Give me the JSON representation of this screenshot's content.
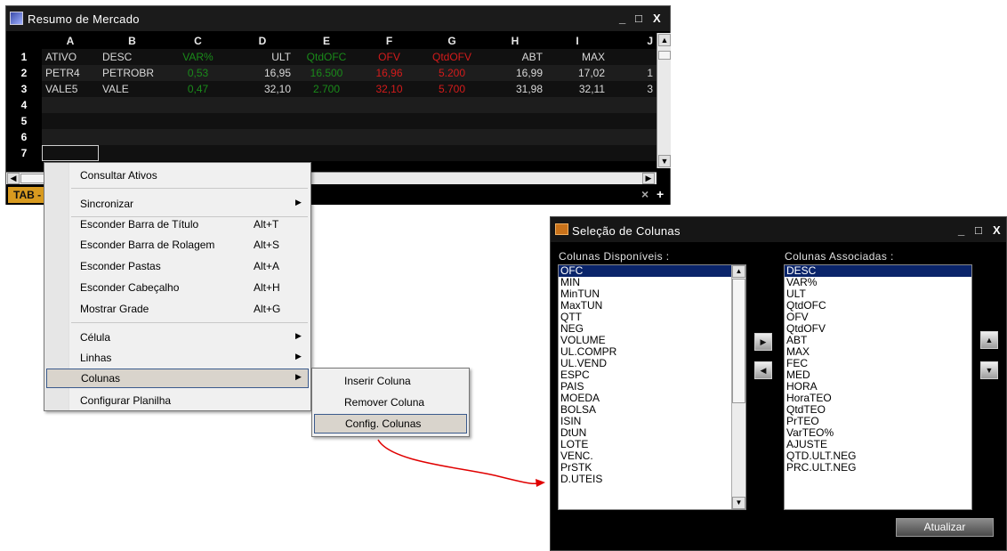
{
  "market_window": {
    "title": "Resumo de Mercado",
    "controls": {
      "minimize": "_",
      "maximize": "□",
      "close": "X"
    },
    "column_letters": [
      "A",
      "B",
      "C",
      "D",
      "E",
      "F",
      "G",
      "H",
      "I",
      "J"
    ],
    "row_numbers": [
      "1",
      "2",
      "3",
      "4",
      "5",
      "6",
      "7"
    ],
    "rows": [
      [
        "ATIVO",
        "DESC",
        "VAR%",
        "ULT",
        "QtdOFC",
        "OFV",
        "QtdOFV",
        "ABT",
        "MAX",
        ""
      ],
      [
        "PETR4",
        "PETROBR",
        "0,53",
        "16,95",
        "16.500",
        "16,96",
        "5.200",
        "16,99",
        "17,02",
        "1"
      ],
      [
        "VALE5",
        "VALE",
        "0,47",
        "32,10",
        "2.700",
        "32,10",
        "5.700",
        "31,98",
        "32,11",
        "3"
      ],
      [
        "",
        "",
        "",
        "",
        "",
        "",
        "",
        "",
        "",
        ""
      ],
      [
        "",
        "",
        "",
        "",
        "",
        "",
        "",
        "",
        "",
        ""
      ],
      [
        "",
        "",
        "",
        "",
        "",
        "",
        "",
        "",
        "",
        ""
      ],
      [
        "",
        "",
        "",
        "",
        "",
        "",
        "",
        "",
        "",
        ""
      ]
    ],
    "tab_label": "TAB -",
    "tab_controls": {
      "close": "×",
      "add": "+"
    }
  },
  "context_menu": {
    "items": [
      {
        "label": "Consultar Ativos",
        "shortcut": "",
        "submenu": false
      },
      {
        "label": "Sincronizar",
        "shortcut": "",
        "submenu": true
      },
      {
        "label": "Esconder Barra de Título",
        "shortcut": "Alt+T",
        "submenu": false
      },
      {
        "label": "Esconder Barra de Rolagem",
        "shortcut": "Alt+S",
        "submenu": false
      },
      {
        "label": "Esconder Pastas",
        "shortcut": "Alt+A",
        "submenu": false
      },
      {
        "label": "Esconder Cabeçalho",
        "shortcut": "Alt+H",
        "submenu": false
      },
      {
        "label": "Mostrar Grade",
        "shortcut": "Alt+G",
        "submenu": false
      },
      {
        "label": "Célula",
        "shortcut": "",
        "submenu": true
      },
      {
        "label": "Linhas",
        "shortcut": "",
        "submenu": true
      },
      {
        "label": "Colunas",
        "shortcut": "",
        "submenu": true
      },
      {
        "label": "Configurar Planilha",
        "shortcut": "",
        "submenu": false
      }
    ],
    "submenu_items": [
      "Inserir Coluna",
      "Remover Coluna",
      "Config. Colunas"
    ]
  },
  "columns_window": {
    "title": "Seleção de Colunas",
    "controls": {
      "minimize": "_",
      "maximize": "□",
      "close": "X"
    },
    "available_label": "Colunas Disponíveis :",
    "associated_label": "Colunas Associadas :",
    "available": [
      "OFC",
      "MIN",
      "MinTUN",
      "MaxTUN",
      "QTT",
      "NEG",
      "VOLUME",
      "UL.COMPR",
      "UL.VEND",
      "ESPC",
      "PAIS",
      "MOEDA",
      "BOLSA",
      "ISIN",
      "DtUN",
      "LOTE",
      "VENC.",
      "PrSTK",
      "D.UTEIS"
    ],
    "associated": [
      "DESC",
      "VAR%",
      "ULT",
      "QtdOFC",
      "OFV",
      "QtdOFV",
      "ABT",
      "MAX",
      "FEC",
      "MED",
      "HORA",
      "HoraTEO",
      "QtdTEO",
      "PrTEO",
      "VarTEO%",
      "AJUSTE",
      "QTD.ULT.NEG",
      "PRC.ULT.NEG"
    ],
    "update_button": "Atualizar"
  },
  "colors": {
    "positive": "#1a8a1a",
    "negative": "#d41b1b",
    "tab_accent": "#d89a1f",
    "selection": "#0a246a",
    "arrow": "#e00000"
  }
}
